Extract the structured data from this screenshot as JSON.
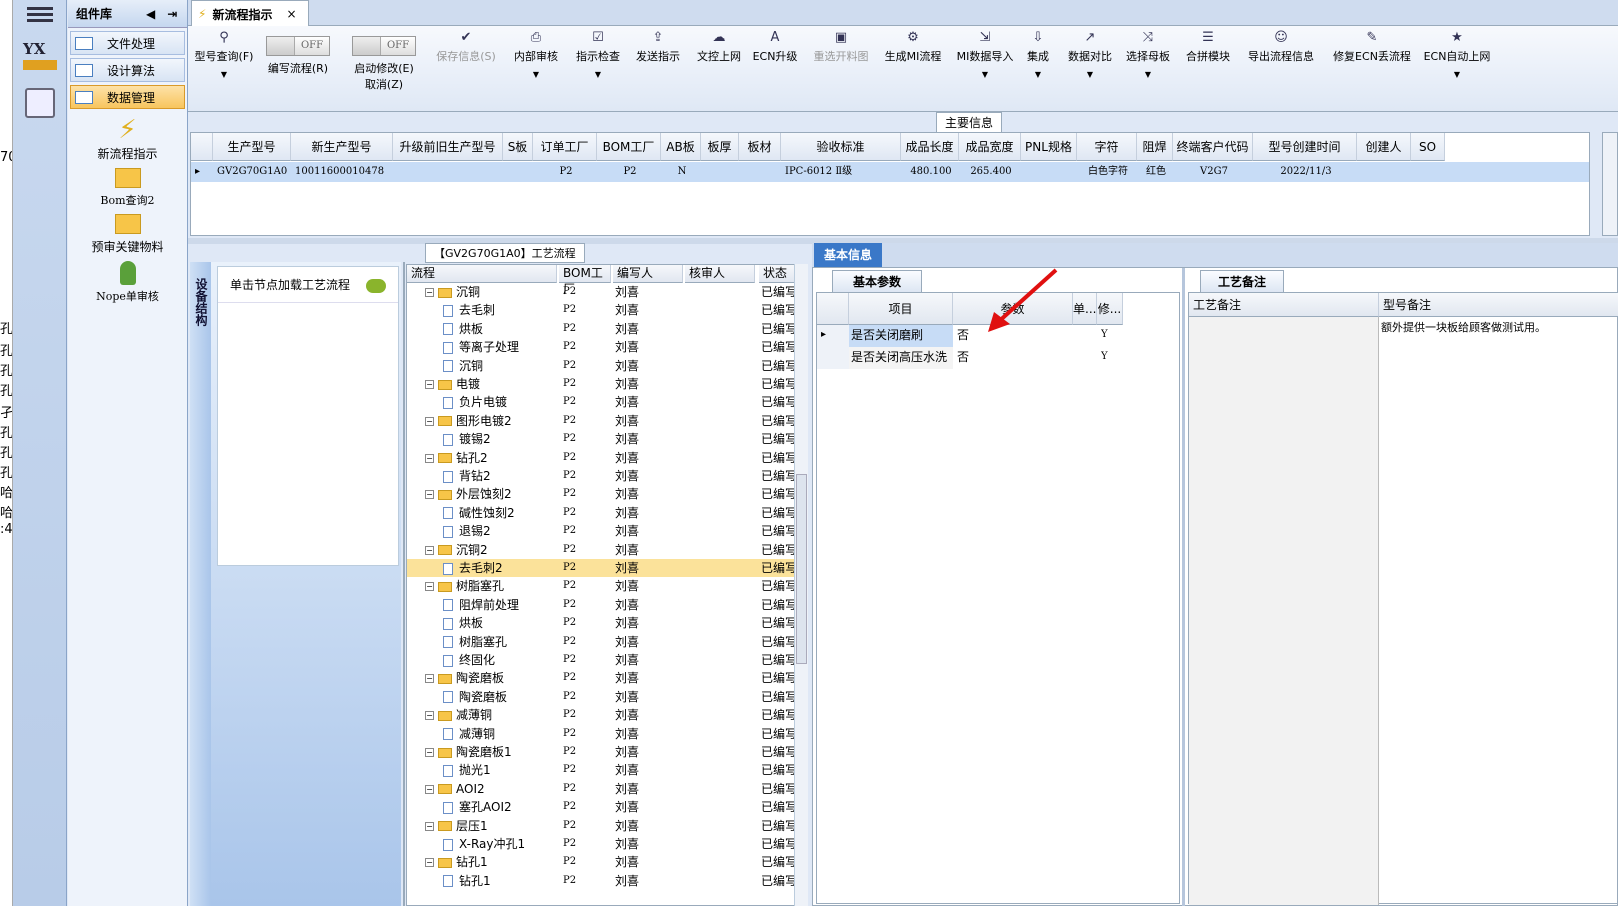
{
  "left_edge_chars": [
    "70",
    "孔",
    "孔",
    "孔",
    "孔",
    "孑",
    "孔",
    "孔",
    "孔",
    "哈",
    "哈",
    ":4"
  ],
  "component_panel": {
    "title": "组件库",
    "items": [
      "文件处理",
      "设计算法",
      "数据管理"
    ],
    "icons": [
      {
        "label": "新流程指示"
      },
      {
        "label": "Bom查询2"
      },
      {
        "label": "预审关键物料"
      },
      {
        "label": "Nope单审核"
      }
    ]
  },
  "tab": {
    "title": "新流程指示",
    "close": "×"
  },
  "toolbar": {
    "items": [
      {
        "label": "型号查询(F)",
        "icon": "search-icon"
      },
      {
        "label": "编写流程(R)",
        "toggle": "OFF"
      },
      {
        "label": "启动修改(E)",
        "label2": "取消(Z)",
        "toggle": "OFF"
      },
      {
        "label": "保存信息(S)",
        "icon": "check-icon"
      },
      {
        "label": "内部审核",
        "icon": "print-icon"
      },
      {
        "label": "指示检查",
        "icon": "checkbox-icon"
      },
      {
        "label": "发送指示",
        "icon": "upload-icon"
      },
      {
        "label": "文控上网",
        "icon": "cloud-icon"
      },
      {
        "label": "ECN升级",
        "icon": "text-icon"
      },
      {
        "label": "重选开料图",
        "icon": "image-icon"
      },
      {
        "label": "生成MI流程",
        "icon": "gears-icon"
      },
      {
        "label": "MI数据导入",
        "icon": "import-icon"
      },
      {
        "label": "集成",
        "icon": "download-icon"
      },
      {
        "label": "数据对比",
        "icon": "compare-icon"
      },
      {
        "label": "选择母板",
        "icon": "shuffle-icon"
      },
      {
        "label": "合拼模块",
        "icon": "list-icon"
      },
      {
        "label": "导出流程信息",
        "icon": "smile-icon"
      },
      {
        "label": "修复ECN丢流程",
        "icon": "wrench-icon"
      },
      {
        "label": "ECN自动上网",
        "icon": "star-icon"
      }
    ]
  },
  "main_info": {
    "title": "主要信息",
    "columns": [
      "生产型号",
      "新生产型号",
      "升级前旧生产型号",
      "S板",
      "订单工厂",
      "BOM工厂",
      "AB板",
      "板厚",
      "板材",
      "验收标准",
      "成品长度",
      "成品宽度",
      "PNL规格",
      "字符",
      "阻焊",
      "终端客户代码",
      "型号创建时间",
      "创建人",
      "SO"
    ],
    "row": [
      "GV2G70G1A0",
      "10011600010478",
      "",
      "",
      "P2",
      "P2",
      "N",
      "",
      "",
      "IPC-6012 Ⅱ级",
      "480.100",
      "265.400",
      "",
      "白色字符",
      "红色",
      "V2G7",
      "2022/11/3",
      "",
      ""
    ]
  },
  "process_panel": {
    "title": "【GV2G70G1A0】工艺流程",
    "side_tab": "设备结构",
    "load_button": "单击节点加载工艺流程",
    "columns": [
      "流程",
      "BOM工厂",
      "编写人",
      "核审人",
      "状态"
    ],
    "rows": [
      {
        "name": "沉铜",
        "level": 0,
        "factory": "P2",
        "writer": "刘喜",
        "status": "已编写"
      },
      {
        "name": "去毛刺",
        "level": 1,
        "factory": "P2",
        "writer": "刘喜",
        "status": "已编写"
      },
      {
        "name": "烘板",
        "level": 1,
        "factory": "P2",
        "writer": "刘喜",
        "status": "已编写"
      },
      {
        "name": "等离子处理",
        "level": 1,
        "factory": "P2",
        "writer": "刘喜",
        "status": "已编写"
      },
      {
        "name": "沉铜",
        "level": 1,
        "factory": "P2",
        "writer": "刘喜",
        "status": "已编写"
      },
      {
        "name": "电镀",
        "level": 0,
        "factory": "P2",
        "writer": "刘喜",
        "status": "已编写"
      },
      {
        "name": "负片电镀",
        "level": 1,
        "factory": "P2",
        "writer": "刘喜",
        "status": "已编写"
      },
      {
        "name": "图形电镀2",
        "level": 0,
        "factory": "P2",
        "writer": "刘喜",
        "status": "已编写"
      },
      {
        "name": "镀锡2",
        "level": 1,
        "factory": "P2",
        "writer": "刘喜",
        "status": "已编写"
      },
      {
        "name": "钻孔2",
        "level": 0,
        "factory": "P2",
        "writer": "刘喜",
        "status": "已编写"
      },
      {
        "name": "背钻2",
        "level": 1,
        "factory": "P2",
        "writer": "刘喜",
        "status": "已编写"
      },
      {
        "name": "外层蚀刻2",
        "level": 0,
        "factory": "P2",
        "writer": "刘喜",
        "status": "已编写"
      },
      {
        "name": "碱性蚀刻2",
        "level": 1,
        "factory": "P2",
        "writer": "刘喜",
        "status": "已编写"
      },
      {
        "name": "退锡2",
        "level": 1,
        "factory": "P2",
        "writer": "刘喜",
        "status": "已编写"
      },
      {
        "name": "沉铜2",
        "level": 0,
        "factory": "P2",
        "writer": "刘喜",
        "status": "已编写"
      },
      {
        "name": "去毛刺2",
        "level": 1,
        "factory": "P2",
        "writer": "刘喜",
        "status": "已编写",
        "selected": true
      },
      {
        "name": "树脂塞孔",
        "level": 0,
        "factory": "P2",
        "writer": "刘喜",
        "status": "已编写"
      },
      {
        "name": "阻焊前处理",
        "level": 1,
        "factory": "P2",
        "writer": "刘喜",
        "status": "已编写"
      },
      {
        "name": "烘板",
        "level": 1,
        "factory": "P2",
        "writer": "刘喜",
        "status": "已编写"
      },
      {
        "name": "树脂塞孔",
        "level": 1,
        "factory": "P2",
        "writer": "刘喜",
        "status": "已编写"
      },
      {
        "name": "终固化",
        "level": 1,
        "factory": "P2",
        "writer": "刘喜",
        "status": "已编写"
      },
      {
        "name": "陶瓷磨板",
        "level": 0,
        "factory": "P2",
        "writer": "刘喜",
        "status": "已编写"
      },
      {
        "name": "陶瓷磨板",
        "level": 1,
        "factory": "P2",
        "writer": "刘喜",
        "status": "已编写"
      },
      {
        "name": "减薄铜",
        "level": 0,
        "factory": "P2",
        "writer": "刘喜",
        "status": "已编写"
      },
      {
        "name": "减薄铜",
        "level": 1,
        "factory": "P2",
        "writer": "刘喜",
        "status": "已编写"
      },
      {
        "name": "陶瓷磨板1",
        "level": 0,
        "factory": "P2",
        "writer": "刘喜",
        "status": "已编写"
      },
      {
        "name": "抛光1",
        "level": 1,
        "factory": "P2",
        "writer": "刘喜",
        "status": "已编写"
      },
      {
        "name": "AOI2",
        "level": 0,
        "factory": "P2",
        "writer": "刘喜",
        "status": "已编写"
      },
      {
        "name": "塞孔AOI2",
        "level": 1,
        "factory": "P2",
        "writer": "刘喜",
        "status": "已编写"
      },
      {
        "name": "层压1",
        "level": 0,
        "factory": "P2",
        "writer": "刘喜",
        "status": "已编写"
      },
      {
        "name": "X-Ray冲孔1",
        "level": 1,
        "factory": "P2",
        "writer": "刘喜",
        "status": "已编写"
      },
      {
        "name": "钻孔1",
        "level": 0,
        "factory": "P2",
        "writer": "刘喜",
        "status": "已编写"
      },
      {
        "name": "钻孔1",
        "level": 1,
        "factory": "P2",
        "writer": "刘喜",
        "status": "已编写"
      }
    ]
  },
  "basic_info": {
    "title": "基本信息",
    "subtab": "基本参数",
    "columns": [
      "项目",
      "参数",
      "单...",
      "修..."
    ],
    "rows": [
      {
        "item": "是否关闭磨刷",
        "param": "否",
        "unit": "",
        "mod": "Y"
      },
      {
        "item": "是否关闭高压水洗",
        "param": "否",
        "unit": "",
        "mod": "Y"
      }
    ]
  },
  "process_notes": {
    "subtab": "工艺备注",
    "columns": [
      "工艺备注",
      "型号备注"
    ],
    "model_note": "额外提供一块板给顾客做测试用。"
  },
  "colors": {
    "accent": "#3a78c8",
    "selected": "#fbe29a",
    "arrow": "#e01010"
  }
}
